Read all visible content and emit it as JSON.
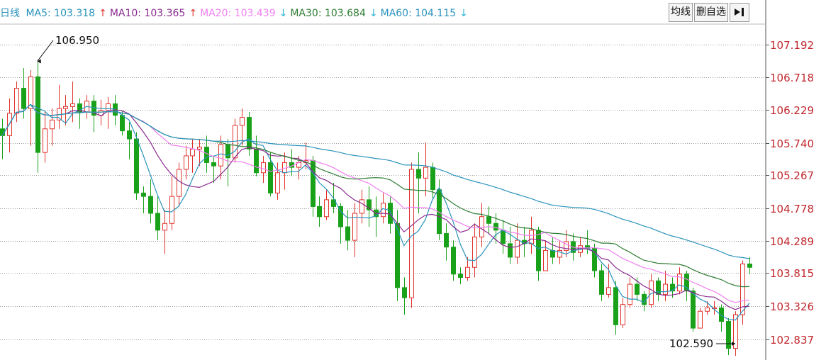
{
  "header": {
    "period_label": "日线",
    "ma_indicators": [
      {
        "name": "MA5",
        "value": "103.318",
        "arrow": "↑",
        "color": "#2a93bd",
        "arrow_color": "#e0322b"
      },
      {
        "name": "MA10",
        "value": "103.365",
        "arrow": "↑",
        "color": "#8a2b8f",
        "arrow_color": "#e0322b"
      },
      {
        "name": "MA20",
        "value": "103.439",
        "arrow": "↓",
        "color": "#f07ff0",
        "arrow_color": "#29b6d6"
      },
      {
        "name": "MA30",
        "value": "103.684",
        "arrow": "↓",
        "color": "#2e7d32",
        "arrow_color": "#29b6d6"
      },
      {
        "name": "MA60",
        "value": "104.115",
        "arrow": "↓",
        "color": "#2a93bd",
        "arrow_color": "#29b6d6"
      }
    ]
  },
  "toolbar": {
    "avg_line_label": "均线",
    "delete_custom_label": "删自选",
    "exit_icon": "exit-arrow-icon"
  },
  "colors": {
    "up": "#e0322b",
    "down": "#1aa11a",
    "axis_text": "#c0272d",
    "grid": "#9e9e9e"
  },
  "chart_data": {
    "type": "candlestick",
    "y_ticks": [
      "107.192",
      "106.718",
      "106.229",
      "105.740",
      "105.267",
      "104.778",
      "104.289",
      "103.815",
      "103.326",
      "102.837"
    ],
    "ylim": [
      102.56,
      107.5
    ],
    "grid": true,
    "annotations": {
      "high": "106.950",
      "low": "102.590"
    },
    "candles": [
      [
        105.95,
        105.85,
        106.1,
        105.5
      ],
      [
        105.85,
        106.18,
        106.4,
        105.6
      ],
      [
        106.18,
        106.55,
        106.65,
        106.05
      ],
      [
        106.55,
        106.25,
        106.85,
        106.1
      ],
      [
        106.25,
        106.72,
        106.82,
        105.7
      ],
      [
        106.72,
        105.6,
        106.95,
        105.3
      ],
      [
        105.6,
        105.95,
        106.2,
        105.45
      ],
      [
        105.95,
        106.08,
        106.25,
        105.7
      ],
      [
        106.08,
        106.25,
        106.6,
        105.95
      ],
      [
        106.25,
        106.28,
        106.45,
        106.0
      ],
      [
        106.28,
        106.32,
        106.65,
        106.05
      ],
      [
        106.32,
        106.2,
        106.4,
        105.95
      ],
      [
        106.2,
        106.36,
        106.45,
        106.1
      ],
      [
        106.36,
        106.15,
        106.45,
        105.9
      ],
      [
        106.15,
        106.22,
        106.38,
        106.0
      ],
      [
        106.22,
        106.32,
        106.42,
        105.95
      ],
      [
        106.32,
        106.15,
        106.45,
        106.0
      ],
      [
        106.15,
        105.92,
        106.22,
        105.85
      ],
      [
        105.92,
        105.8,
        106.05,
        105.5
      ],
      [
        105.8,
        105.0,
        105.9,
        104.9
      ],
      [
        105.0,
        104.95,
        105.1,
        104.7
      ],
      [
        104.95,
        104.7,
        105.2,
        104.55
      ],
      [
        104.7,
        104.45,
        104.95,
        104.3
      ],
      [
        104.45,
        104.55,
        104.75,
        104.1
      ],
      [
        104.55,
        104.95,
        105.25,
        104.45
      ],
      [
        104.95,
        105.35,
        105.45,
        104.8
      ],
      [
        105.35,
        105.55,
        105.7,
        105.2
      ],
      [
        105.55,
        105.65,
        105.8,
        105.3
      ],
      [
        105.65,
        105.68,
        105.8,
        105.4
      ],
      [
        105.68,
        105.45,
        105.85,
        105.3
      ],
      [
        105.45,
        105.4,
        105.55,
        105.15
      ],
      [
        105.4,
        105.72,
        105.85,
        105.2
      ],
      [
        105.72,
        105.52,
        105.8,
        105.1
      ],
      [
        105.52,
        106.0,
        106.1,
        105.45
      ],
      [
        106.0,
        106.12,
        106.25,
        105.7
      ],
      [
        106.12,
        105.65,
        106.2,
        105.55
      ],
      [
        105.65,
        105.3,
        105.85,
        105.25
      ],
      [
        105.3,
        105.45,
        105.55,
        105.15
      ],
      [
        105.45,
        105.0,
        105.6,
        104.95
      ],
      [
        105.0,
        105.3,
        105.45,
        104.9
      ],
      [
        105.3,
        105.45,
        105.6,
        105.05
      ],
      [
        105.45,
        105.38,
        105.65,
        105.25
      ],
      [
        105.38,
        105.45,
        105.55,
        105.2
      ],
      [
        105.45,
        105.48,
        105.75,
        105.35
      ],
      [
        105.48,
        104.8,
        105.55,
        104.65
      ],
      [
        104.8,
        104.65,
        104.95,
        104.5
      ],
      [
        104.65,
        104.9,
        105.05,
        104.6
      ],
      [
        104.9,
        104.8,
        105.15,
        104.7
      ],
      [
        104.8,
        104.5,
        104.85,
        104.25
      ],
      [
        104.5,
        104.3,
        104.75,
        104.15
      ],
      [
        104.3,
        104.7,
        104.85,
        104.05
      ],
      [
        104.7,
        104.9,
        105.05,
        104.55
      ],
      [
        104.9,
        104.75,
        105.1,
        104.5
      ],
      [
        104.75,
        104.65,
        104.95,
        104.35
      ],
      [
        104.65,
        104.85,
        105.0,
        104.55
      ],
      [
        104.85,
        104.55,
        104.95,
        104.4
      ],
      [
        104.55,
        103.6,
        104.75,
        103.4
      ],
      [
        103.6,
        103.45,
        103.75,
        103.2
      ],
      [
        103.45,
        105.35,
        105.45,
        103.3
      ],
      [
        105.35,
        105.22,
        105.6,
        104.7
      ],
      [
        105.22,
        105.38,
        105.75,
        104.95
      ],
      [
        105.38,
        105.05,
        105.45,
        104.9
      ],
      [
        105.05,
        104.4,
        105.2,
        104.3
      ],
      [
        104.4,
        104.2,
        104.55,
        104.0
      ],
      [
        104.2,
        103.8,
        104.3,
        103.7
      ],
      [
        103.8,
        103.75,
        103.9,
        103.65
      ],
      [
        103.75,
        103.9,
        104.05,
        103.7
      ],
      [
        103.9,
        104.35,
        104.55,
        103.75
      ],
      [
        104.35,
        104.65,
        104.85,
        104.2
      ],
      [
        104.65,
        104.55,
        104.8,
        104.4
      ],
      [
        104.55,
        104.45,
        104.7,
        104.25
      ],
      [
        104.45,
        104.25,
        104.6,
        104.1
      ],
      [
        104.25,
        104.05,
        104.5,
        103.95
      ],
      [
        104.05,
        104.3,
        104.55,
        103.95
      ],
      [
        104.3,
        104.25,
        104.5,
        104.05
      ],
      [
        104.25,
        104.45,
        104.65,
        104.1
      ],
      [
        104.45,
        103.85,
        104.5,
        103.7
      ],
      [
        103.85,
        104.15,
        104.3,
        103.9
      ],
      [
        104.15,
        104.05,
        104.35,
        103.95
      ],
      [
        104.05,
        104.15,
        104.3,
        103.95
      ],
      [
        104.15,
        104.28,
        104.45,
        104.05
      ],
      [
        104.28,
        104.12,
        104.4,
        104.0
      ],
      [
        104.12,
        104.22,
        104.35,
        104.05
      ],
      [
        104.22,
        104.18,
        104.45,
        104.1
      ],
      [
        104.18,
        103.85,
        104.25,
        103.75
      ],
      [
        103.85,
        103.5,
        103.95,
        103.4
      ],
      [
        103.5,
        103.6,
        103.95,
        103.45
      ],
      [
        103.6,
        103.05,
        103.7,
        102.9
      ],
      [
        103.05,
        103.35,
        103.45,
        103.0
      ],
      [
        103.35,
        103.65,
        103.75,
        103.3
      ],
      [
        103.65,
        103.5,
        103.75,
        103.4
      ],
      [
        103.5,
        103.35,
        103.55,
        103.25
      ],
      [
        103.35,
        103.7,
        103.8,
        103.3
      ],
      [
        103.7,
        103.5,
        103.75,
        103.4
      ],
      [
        103.5,
        103.65,
        103.85,
        103.4
      ],
      [
        103.65,
        103.55,
        103.75,
        103.45
      ],
      [
        103.55,
        103.8,
        103.9,
        103.5
      ],
      [
        103.8,
        103.55,
        103.85,
        103.4
      ],
      [
        103.55,
        103.0,
        103.6,
        102.95
      ],
      [
        103.0,
        103.25,
        103.3,
        103.05
      ],
      [
        103.25,
        103.3,
        103.4,
        103.2
      ],
      [
        103.3,
        103.3,
        103.4,
        103.2
      ],
      [
        103.3,
        103.1,
        103.35,
        102.95
      ],
      [
        103.1,
        102.7,
        103.15,
        102.6
      ],
      [
        102.7,
        103.2,
        103.25,
        102.59
      ],
      [
        103.2,
        103.95,
        104.0,
        103.05
      ],
      [
        103.95,
        103.9,
        104.05,
        103.8
      ]
    ],
    "series": [
      {
        "name": "MA5",
        "color": "#2a93bd",
        "values": [
          [
            0,
            105.9
          ],
          [
            10,
            106.1
          ],
          [
            20,
            106.2
          ],
          [
            30,
            106.15
          ],
          [
            40,
            106.28
          ],
          [
            50,
            106.3
          ],
          [
            60,
            106.25
          ],
          [
            70,
            106.1
          ],
          [
            75,
            105.9
          ],
          [
            80,
            105.4
          ],
          [
            85,
            105.0
          ],
          [
            90,
            104.9
          ],
          [
            95,
            104.75
          ],
          [
            100,
            104.65
          ],
          [
            105,
            104.78
          ],
          [
            110,
            105.0
          ],
          [
            115,
            105.25
          ],
          [
            120,
            105.4
          ],
          [
            125,
            105.48
          ],
          [
            130,
            105.42
          ],
          [
            135,
            105.5
          ],
          [
            140,
            105.7
          ],
          [
            145,
            105.85
          ],
          [
            150,
            105.75
          ],
          [
            155,
            105.5
          ],
          [
            160,
            105.35
          ],
          [
            165,
            105.33
          ],
          [
            170,
            105.38
          ],
          [
            175,
            105.4
          ],
          [
            180,
            105.5
          ],
          [
            185,
            105.25
          ],
          [
            190,
            104.95
          ],
          [
            195,
            104.8
          ],
          [
            200,
            104.7
          ],
          [
            205,
            104.5
          ],
          [
            210,
            104.4
          ],
          [
            215,
            104.55
          ],
          [
            220,
            104.7
          ],
          [
            225,
            104.75
          ],
          [
            230,
            104.7
          ],
          [
            235,
            104.55
          ],
          [
            240,
            104.35
          ],
          [
            245,
            104.0
          ],
          [
            250,
            103.85
          ],
          [
            255,
            104.2
          ],
          [
            260,
            104.8
          ],
          [
            265,
            105.0
          ],
          [
            270,
            104.85
          ],
          [
            275,
            104.55
          ],
          [
            280,
            104.2
          ],
          [
            285,
            104.0
          ],
          [
            290,
            103.85
          ],
          [
            295,
            103.9
          ],
          [
            300,
            104.05
          ],
          [
            305,
            104.3
          ],
          [
            310,
            104.35
          ],
          [
            315,
            104.3
          ],
          [
            320,
            104.25
          ],
          [
            325,
            104.3
          ],
          [
            330,
            104.25
          ],
          [
            335,
            104.1
          ],
          [
            340,
            104.15
          ],
          [
            345,
            104.2
          ],
          [
            350,
            104.2
          ],
          [
            355,
            104.15
          ],
          [
            360,
            103.9
          ],
          [
            365,
            103.65
          ],
          [
            370,
            103.5
          ],
          [
            375,
            103.45
          ],
          [
            380,
            103.5
          ],
          [
            385,
            103.6
          ],
          [
            390,
            103.65
          ],
          [
            395,
            103.65
          ],
          [
            400,
            103.55
          ],
          [
            405,
            103.45
          ],
          [
            410,
            103.25
          ],
          [
            415,
            103.05
          ],
          [
            420,
            103.1
          ],
          [
            425,
            103.25
          ],
          [
            430,
            103.4
          ]
        ]
      },
      {
        "name": "MA10",
        "color": "#8a2b8f",
        "values": []
      },
      {
        "name": "MA20",
        "color": "#f07ff0",
        "values": []
      },
      {
        "name": "MA30",
        "color": "#2e7d32",
        "values": []
      },
      {
        "name": "MA60",
        "color": "#2a93bd",
        "values": []
      }
    ]
  }
}
